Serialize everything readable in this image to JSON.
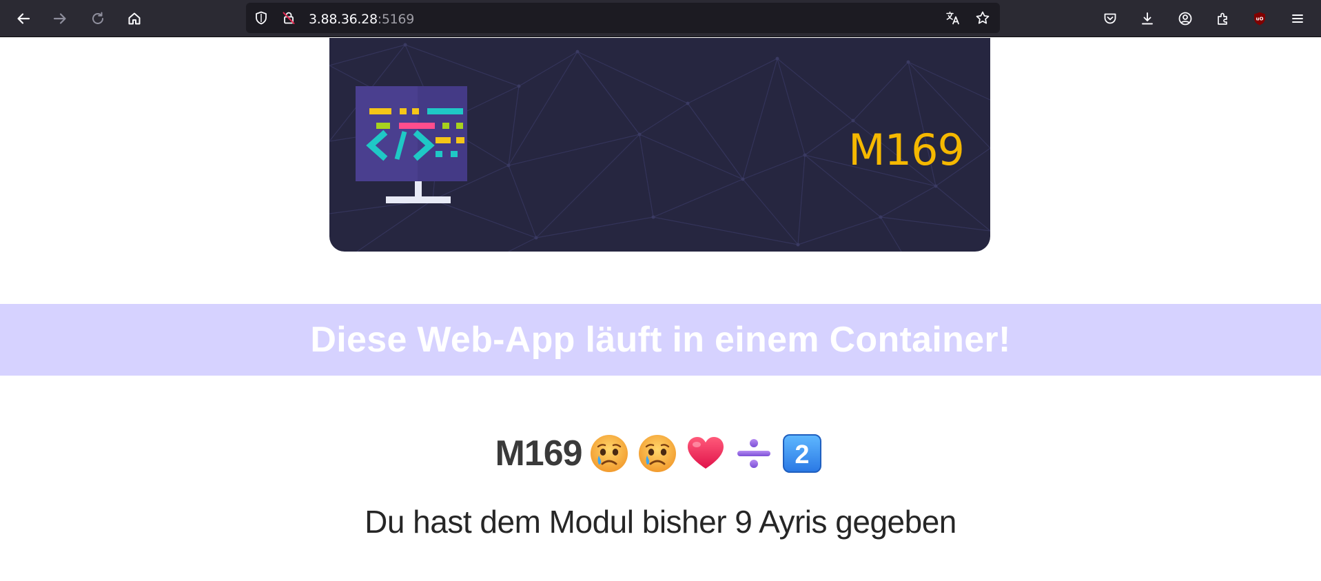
{
  "browser": {
    "url_host": "3.88.36.28",
    "url_port": ":5169",
    "icons": [
      "back-icon",
      "forward-icon",
      "reload-icon",
      "home-icon",
      "shield-icon",
      "insecure-lock-icon",
      "translate-icon",
      "bookmark-star-icon",
      "pocket-icon",
      "download-icon",
      "account-icon",
      "extensions-icon",
      "ublock-icon",
      "menu-icon"
    ]
  },
  "banner": {
    "title": "M169",
    "background": "#262640",
    "accent": "#f5b800",
    "icon": "code-monitor-icon"
  },
  "strip": {
    "message": "Diese Web-App läuft in einem Container!",
    "background": "#d6d2ff"
  },
  "module": {
    "name": "M169",
    "emojis": [
      "crying-face-emoji",
      "crying-face-emoji",
      "red-heart-emoji",
      "division-sign-emoji",
      "keycap-2-emoji"
    ]
  },
  "status": {
    "message": "Du hast dem Modul bisher 9 Ayris gegeben"
  }
}
